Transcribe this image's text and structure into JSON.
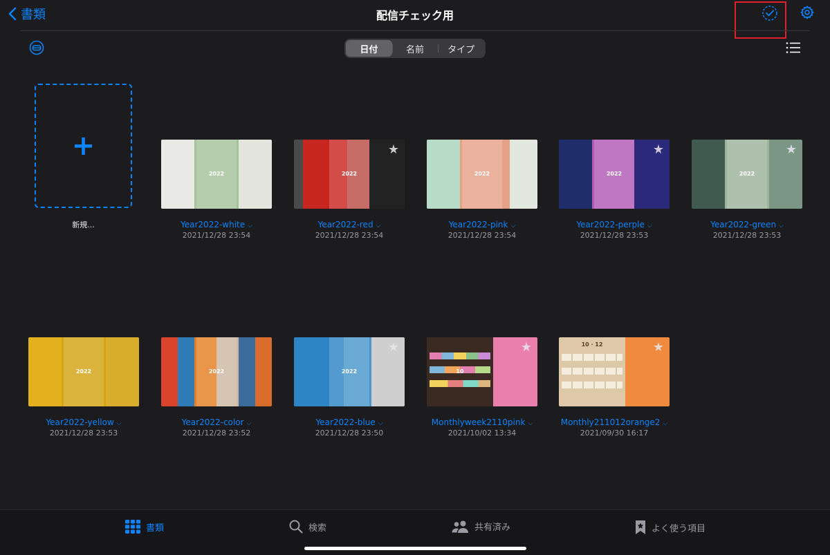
{
  "header": {
    "back_label": "書類",
    "title": "配信チェック用"
  },
  "sort": {
    "options": [
      "日付",
      "名前",
      "タイプ"
    ],
    "selected": "日付"
  },
  "new_document": {
    "label": "新規..."
  },
  "documents": [
    {
      "name": "Year2022-white",
      "date": "2021/12/28 23:54",
      "thumb_text": "2022",
      "favorite": false
    },
    {
      "name": "Year2022-red",
      "date": "2021/12/28 23:54",
      "thumb_text": "2022",
      "favorite": true
    },
    {
      "name": "Year2022-pink",
      "date": "2021/12/28 23:54",
      "thumb_text": "2022",
      "favorite": false
    },
    {
      "name": "Year2022-perple",
      "date": "2021/12/28 23:53",
      "thumb_text": "2022",
      "favorite": true
    },
    {
      "name": "Year2022-green",
      "date": "2021/12/28 23:53",
      "thumb_text": "2022",
      "favorite": true
    },
    {
      "name": "Year2022-yellow",
      "date": "2021/12/28 23:53",
      "thumb_text": "2022",
      "favorite": false
    },
    {
      "name": "Year2022-color",
      "date": "2021/12/28 23:52",
      "thumb_text": "2022",
      "favorite": false
    },
    {
      "name": "Year2022-blue",
      "date": "2021/12/28 23:50",
      "thumb_text": "2022",
      "favorite": true
    },
    {
      "name": "Monthlyweek2110pink",
      "date": "2021/10/02 13:34",
      "thumb_text": "10",
      "favorite": true
    },
    {
      "name": "Monthly211012orange2",
      "date": "2021/09/30 16:17",
      "thumb_text": "10 · 12",
      "favorite": true
    }
  ],
  "tabbar": {
    "items": [
      {
        "label": "書類",
        "icon": "grid-icon",
        "active": true
      },
      {
        "label": "検索",
        "icon": "search-icon",
        "active": false
      },
      {
        "label": "共有済み",
        "icon": "people-icon",
        "active": false
      },
      {
        "label": "よく使う項目",
        "icon": "bookmark-icon",
        "active": false
      }
    ]
  },
  "colors": {
    "accent": "#0a84ff",
    "background": "#1c1c1e",
    "highlight": "#e0202a"
  }
}
